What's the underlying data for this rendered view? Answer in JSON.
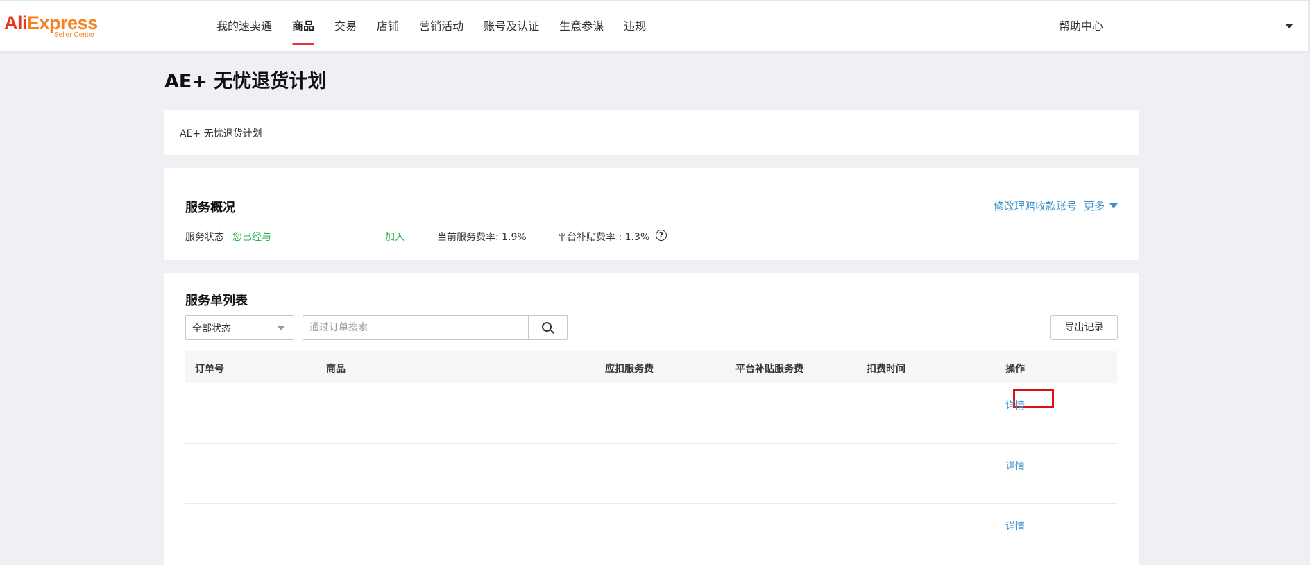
{
  "header": {
    "logo_main_ali": "Ali",
    "logo_main_express": "Express",
    "logo_sub": "Seller Center",
    "nav": [
      {
        "label": "我的速卖通",
        "active": false
      },
      {
        "label": "商品",
        "active": true
      },
      {
        "label": "交易",
        "active": false
      },
      {
        "label": "店铺",
        "active": false
      },
      {
        "label": "营销活动",
        "active": false
      },
      {
        "label": "账号及认证",
        "active": false
      },
      {
        "label": "生意参谋",
        "active": false
      },
      {
        "label": "违规",
        "active": false
      }
    ],
    "help": "帮助中心"
  },
  "page": {
    "title": "AE+ 无忧退货计划",
    "breadcrumb": "AE+ 无忧退货计划"
  },
  "overview": {
    "title": "服务概况",
    "modify_link": "修改理赔收款账号",
    "more_link": "更多",
    "status_label": "服务状态",
    "status_value": "您已经与",
    "status_value_2": "加入",
    "current_rate": "当前服务费率: 1.9%",
    "subsidy_rate": "平台补贴费率 : 1.3%"
  },
  "list": {
    "title": "服务单列表",
    "status_select": "全部状态",
    "search_placeholder": "通过订单搜索",
    "export_button": "导出记录",
    "columns": [
      "订单号",
      "商品",
      "应扣服务费",
      "平台补贴服务费",
      "扣费时间",
      "操作"
    ],
    "rows": [
      {
        "action": "详情"
      },
      {
        "action": "详情"
      },
      {
        "action": "详情"
      }
    ]
  },
  "colors": {
    "accent_red": "#e5373d",
    "link_blue": "#3b8fc9",
    "status_green": "#27b34a"
  }
}
